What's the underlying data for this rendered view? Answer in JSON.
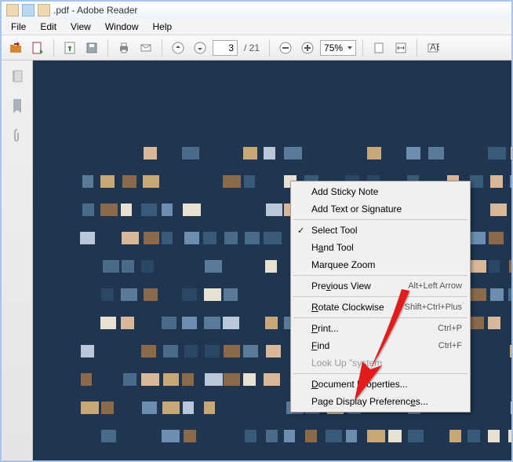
{
  "title": ".pdf - Adobe Reader",
  "menu": {
    "file": "File",
    "edit": "Edit",
    "view": "View",
    "window": "Window",
    "help": "Help"
  },
  "toolbar": {
    "page_current": "3",
    "page_total": "/ 21",
    "zoom": "75%"
  },
  "ctx": {
    "add_sticky": "Add Sticky Note",
    "add_text": "Add Text or Signature",
    "select_tool": "Select Tool",
    "hand_tool": "Hand Tool",
    "marquee": "Marquee Zoom",
    "prev_view": "Previous View",
    "prev_view_sc": "Alt+Left Arrow",
    "rotate": "Rotate Clockwise",
    "rotate_sc": "Shift+Ctrl+Plus",
    "print": "Print...",
    "print_sc": "Ctrl+P",
    "find": "Find",
    "find_sc": "Ctrl+F",
    "lookup": "Look Up \"system",
    "doc_props": "Document Properties...",
    "page_prefs": "Page Display Preferences..."
  }
}
